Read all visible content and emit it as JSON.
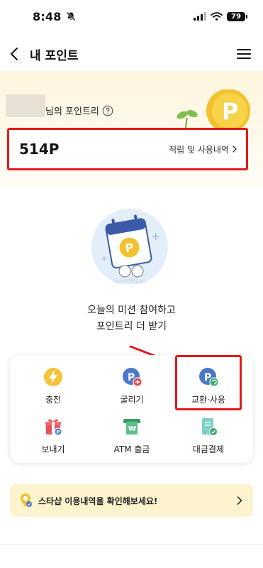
{
  "status_bar": {
    "time": "8:48",
    "battery": "79"
  },
  "header": {
    "title": "내 포인트"
  },
  "points": {
    "title": "님의 포인트리",
    "value": "514P",
    "history_link": "적립 및 사용내역"
  },
  "mission": {
    "watermark": "SmartMLab",
    "line1": "오늘의 미션 참여하고",
    "line2": "포인트리 더 받기"
  },
  "actions": {
    "charge": "충전",
    "grow": "굴리기",
    "exchange": "교환·사용",
    "send": "보내기",
    "atm": "ATM 출금",
    "payment": "대금결제"
  },
  "banner": {
    "text": "스타샵 이용내역을 확인해보세요!"
  },
  "colors": {
    "highlight_red": "#e01a1a",
    "coin_gold": "#f2c12e",
    "banner_bg": "#fdf3cf",
    "point_bg": "#fdf5dd"
  }
}
